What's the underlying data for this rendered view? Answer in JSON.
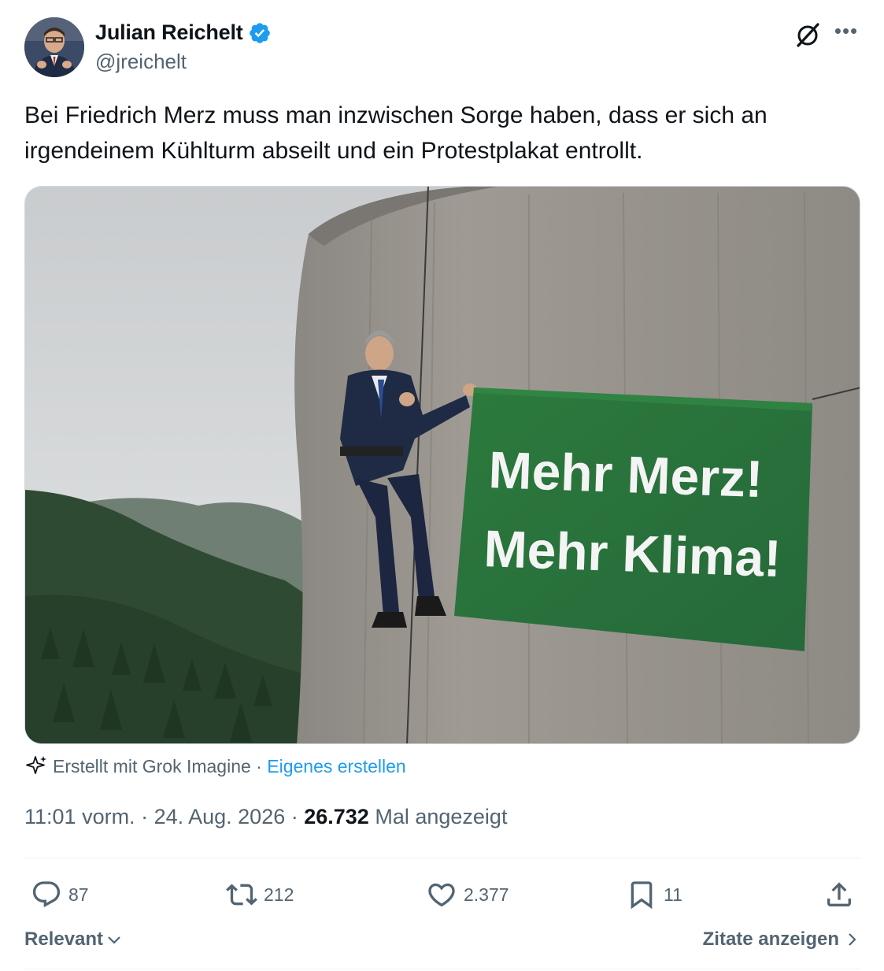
{
  "author": {
    "display_name": "Julian Reichelt",
    "handle": "@jreichelt",
    "verified": true,
    "avatar_icon": "profile-photo"
  },
  "tweet": {
    "text": "Bei Friedrich Merz muss man inzwischen Sorge haben, dass er sich an irgendeinem Kühlturm abseilt und ein Protestplakat entrollt."
  },
  "media": {
    "banner_line1": "Mehr Merz!",
    "banner_line2": "Mehr Klima!"
  },
  "grok_note": {
    "label": "Erstellt mit Grok Imagine",
    "separator": " · ",
    "link": "Eigenes erstellen"
  },
  "meta": {
    "time": "11:01 vorm.",
    "date": "24. Aug. 2026",
    "views": "26.732",
    "views_label": "Mal angezeigt"
  },
  "actions": {
    "replies": "87",
    "reposts": "212",
    "likes": "2.377",
    "bookmarks": "11"
  },
  "footer": {
    "sort_label": "Relevant",
    "quotes_label": "Zitate anzeigen"
  },
  "colors": {
    "text": "#0f1419",
    "secondary": "#536471",
    "accent": "#1d9bf0",
    "banner_green": "#2f7a3c"
  }
}
